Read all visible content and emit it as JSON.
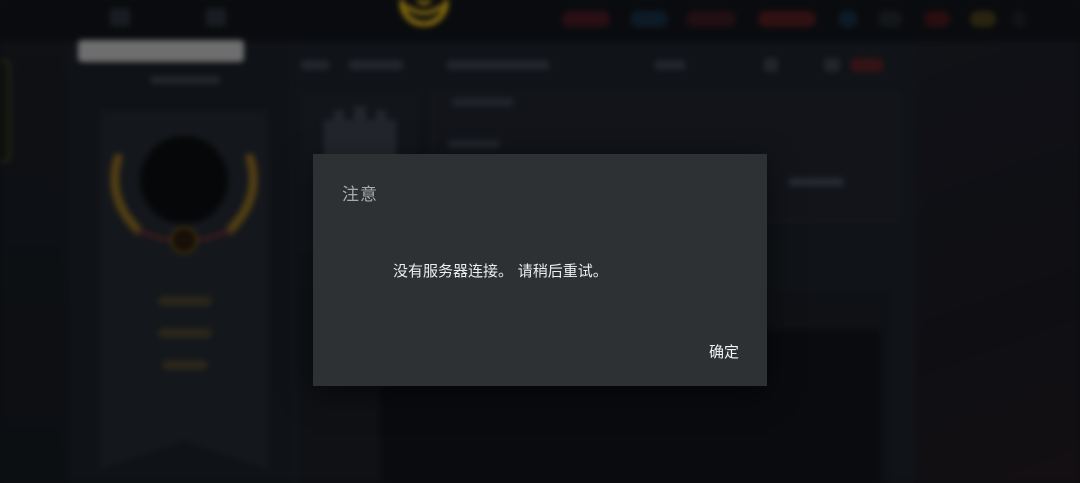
{
  "dialog": {
    "title": "注意",
    "message": "没有服务器连接。 请稍后重试。",
    "ok_label": "确定"
  },
  "colors": {
    "dialog_background": "#2d3134",
    "dialog_title": "#a7abad",
    "dialog_text": "#eceeef",
    "brand_gold": "#f2c21b"
  },
  "icons": {
    "brand_logo": "gold-emblem-icon",
    "profile_crest": "laurel-crest-icon",
    "castle": "castle-icon"
  }
}
